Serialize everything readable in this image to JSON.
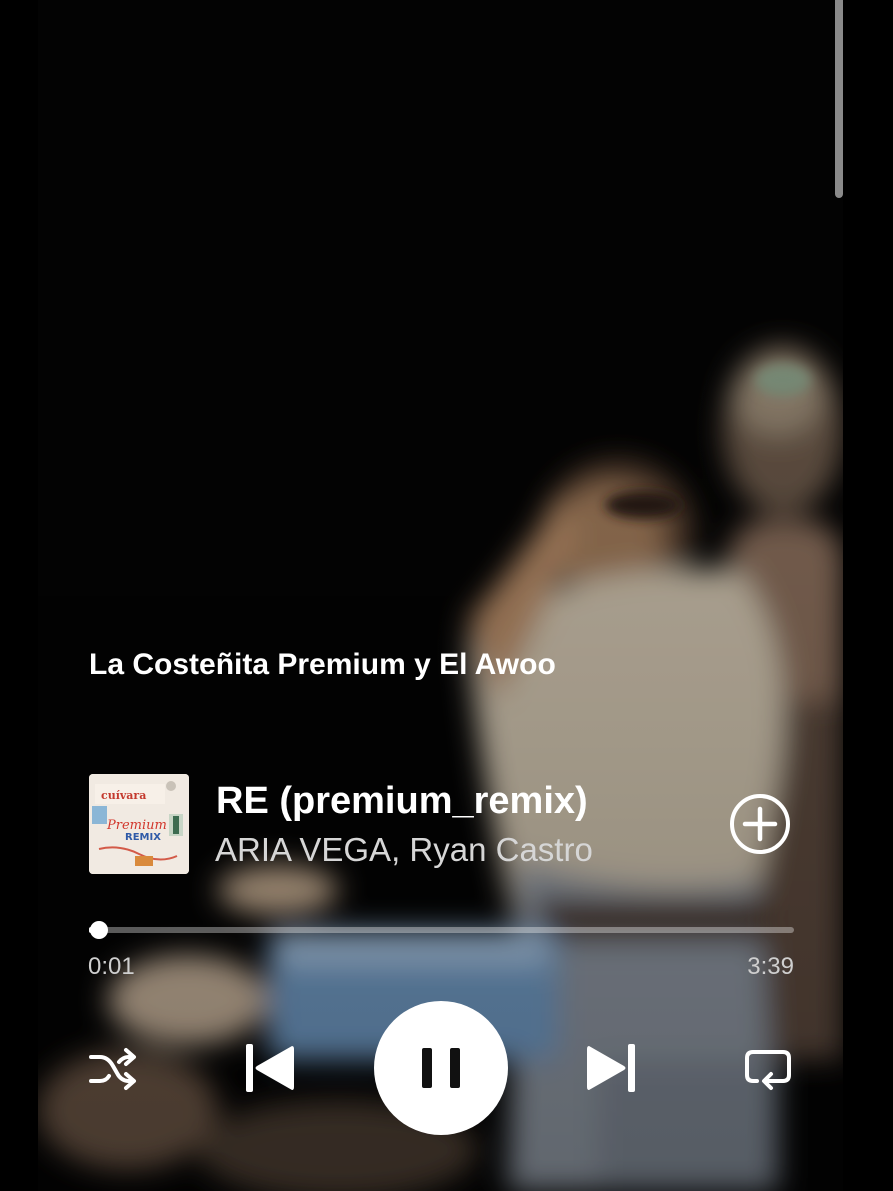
{
  "player": {
    "canvas_title": "La Costeñita Premium y El Awoo",
    "track": {
      "title": "RE (premium_remix)",
      "artists": "ARIA VEGA, Ryan Castro"
    },
    "album_art": {
      "text_top": "cuívara",
      "text_mid": "Premium",
      "text_remix": "REMIX"
    },
    "progress": {
      "elapsed": "0:01",
      "total": "3:39",
      "fraction": 0.005
    },
    "controls": {
      "shuffle_icon": "shuffle-icon",
      "previous_icon": "skip-previous-icon",
      "play_pause_icon": "pause-icon",
      "next_icon": "skip-next-icon",
      "repeat_icon": "repeat-icon",
      "add_icon": "add-circle-icon"
    },
    "colors": {
      "background": "#050505",
      "foreground": "#ffffff",
      "secondary_text": "#d6d6d6"
    }
  }
}
